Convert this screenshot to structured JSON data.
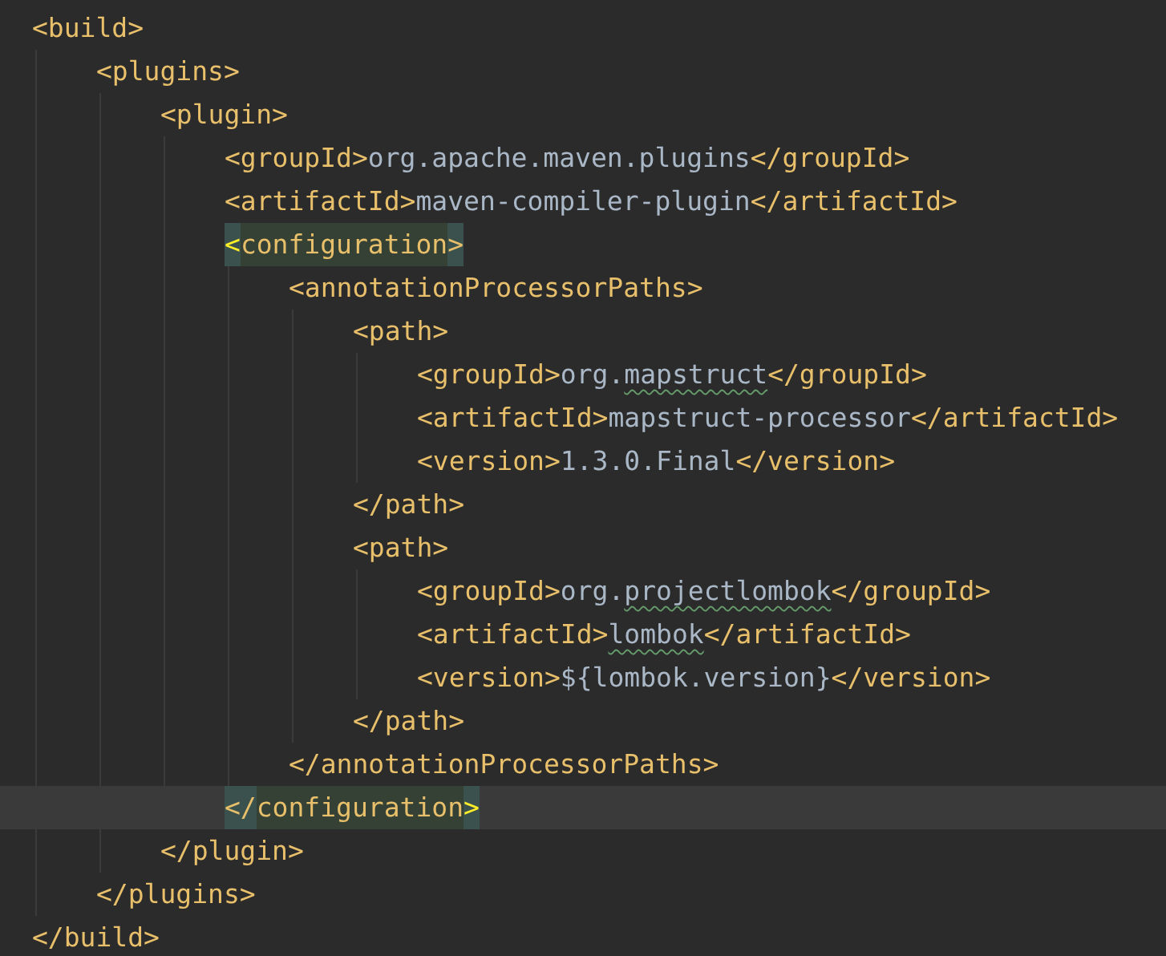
{
  "editor": {
    "root": {
      "open": "<build>",
      "close": "</build>",
      "children": [
        {
          "open": "<plugins>",
          "close": "</plugins>",
          "children": [
            {
              "open": "<plugin>",
              "close": "</plugin>",
              "children": [
                {
                  "open": "<groupId>",
                  "value_parts": [
                    {
                      "text": "org.apache.maven.plugins",
                      "typo": false
                    }
                  ],
                  "close": "</groupId>"
                },
                {
                  "open": "<artifactId>",
                  "value_parts": [
                    {
                      "text": "maven-compiler-plugin",
                      "typo": false
                    }
                  ],
                  "close": "</artifactId>"
                },
                {
                  "open": "<configuration>",
                  "close": "</configuration>",
                  "highlighted": true,
                  "caret_on_close": true,
                  "children": [
                    {
                      "open": "<annotationProcessorPaths>",
                      "close": "</annotationProcessorPaths>",
                      "children": [
                        {
                          "open": "<path>",
                          "close": "</path>",
                          "children": [
                            {
                              "open": "<groupId>",
                              "value_parts": [
                                {
                                  "text": "org.",
                                  "typo": false
                                },
                                {
                                  "text": "mapstruct",
                                  "typo": true
                                }
                              ],
                              "close": "</groupId>"
                            },
                            {
                              "open": "<artifactId>",
                              "value_parts": [
                                {
                                  "text": "mapstruct-processor",
                                  "typo": false
                                }
                              ],
                              "close": "</artifactId>"
                            },
                            {
                              "open": "<version>",
                              "value_parts": [
                                {
                                  "text": "1.3.0.Final",
                                  "typo": false
                                }
                              ],
                              "close": "</version>"
                            }
                          ]
                        },
                        {
                          "open": "<path>",
                          "close": "</path>",
                          "children": [
                            {
                              "open": "<groupId>",
                              "value_parts": [
                                {
                                  "text": "org.",
                                  "typo": false
                                },
                                {
                                  "text": "projectlombok",
                                  "typo": true
                                }
                              ],
                              "close": "</groupId>"
                            },
                            {
                              "open": "<artifactId>",
                              "value_parts": [
                                {
                                  "text": "lombok",
                                  "typo": true
                                }
                              ],
                              "close": "</artifactId>"
                            },
                            {
                              "open": "<version>",
                              "value_parts": [
                                {
                                  "text": "${lombok.version}",
                                  "typo": false
                                }
                              ],
                              "close": "</version>"
                            }
                          ]
                        }
                      ]
                    }
                  ]
                }
              ]
            }
          ]
        }
      ]
    }
  }
}
